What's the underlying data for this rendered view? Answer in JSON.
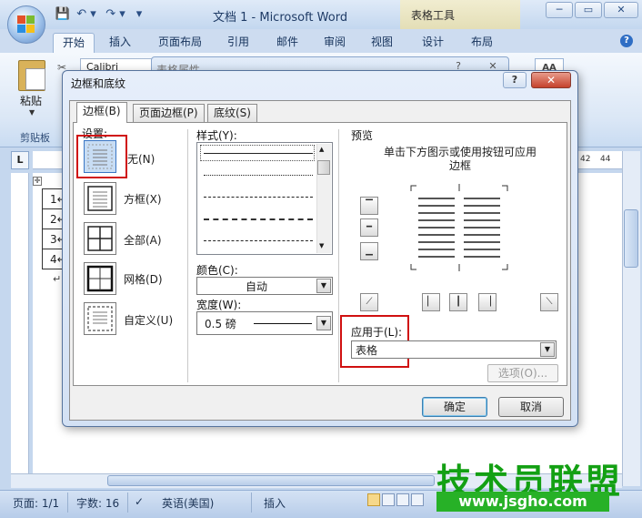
{
  "window": {
    "title": "文档 1 - Microsoft Word",
    "context_tab_group": "表格工具",
    "controls": {
      "minimize": "─",
      "restore": "▭",
      "close": "✕"
    }
  },
  "quick_access": {
    "save": "💾",
    "undo": "↶ ▾",
    "redo": "↷ ▾",
    "customize": "▾"
  },
  "ribbon": {
    "tabs": [
      {
        "label": "开始",
        "active": true
      },
      {
        "label": "插入"
      },
      {
        "label": "页面布局"
      },
      {
        "label": "引用"
      },
      {
        "label": "邮件"
      },
      {
        "label": "审阅"
      },
      {
        "label": "视图"
      },
      {
        "label": "设计"
      },
      {
        "label": "布局"
      }
    ],
    "help": "?",
    "paste_label": "粘贴",
    "clipboard_group": "剪贴板",
    "font_name": "Calibri",
    "style_icon": "AA"
  },
  "table_properties_dialog": {
    "title": "表格属性",
    "help": "?",
    "close": "✕"
  },
  "ruler": {
    "corner": "L",
    "nums": [
      "42",
      "44"
    ]
  },
  "document": {
    "table_rows": [
      "1↵",
      "2↵",
      "3↵",
      "4↵"
    ],
    "table_handle": "✛",
    "para_mark": "↵"
  },
  "status_bar": {
    "page": "页面: 1/1",
    "words": "字数: 16",
    "language": "英语(美国)",
    "mode": "插入"
  },
  "watermark": {
    "text": "技术员联盟",
    "url": "www.jsgho.com"
  },
  "dialog": {
    "title": "边框和底纹",
    "help": "?",
    "close": "✕",
    "tabs": [
      {
        "label": "边框(B)",
        "active": true
      },
      {
        "label": "页面边框(P)"
      },
      {
        "label": "底纹(S)"
      }
    ],
    "settings_label": "设置:",
    "settings": [
      {
        "label": "无(N)",
        "selected": true
      },
      {
        "label": "方框(X)"
      },
      {
        "label": "全部(A)"
      },
      {
        "label": "网格(D)"
      },
      {
        "label": "自定义(U)"
      }
    ],
    "style_label": "样式(Y):",
    "color_label": "颜色(C):",
    "color_value": "自动",
    "width_label": "宽度(W):",
    "width_value": "0.5 磅",
    "preview_label": "预览",
    "preview_hint": "单击下方图示或使用按钮可应用边框",
    "apply_label": "应用于(L):",
    "apply_value": "表格",
    "options_button": "选项(O)...",
    "ok_button": "确定",
    "cancel_button": "取消"
  }
}
